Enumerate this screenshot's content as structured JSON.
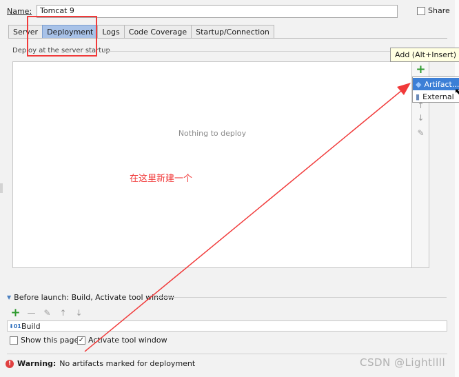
{
  "dialog": {
    "name_label": "Name:",
    "name_value": "Tomcat 9",
    "share_label": "Share",
    "share_checked": false
  },
  "tabs": [
    {
      "label": "Server",
      "active": false
    },
    {
      "label": "Deployment",
      "active": true
    },
    {
      "label": "Logs",
      "active": false
    },
    {
      "label": "Code Coverage",
      "active": false
    },
    {
      "label": "Startup/Connection",
      "active": false
    }
  ],
  "deployment": {
    "group_label": "Deploy at the server startup",
    "empty_text": "Nothing to deploy",
    "toolbar_icons": [
      "add-icon",
      "arrow-up-icon",
      "arrow-down-icon",
      "edit-icon"
    ],
    "tooltip": "Add (Alt+Insert)",
    "popup_items": [
      {
        "label": "Artifact...",
        "icon": "artifact-icon",
        "selected": true
      },
      {
        "label": "External",
        "icon": "external-icon",
        "selected": false
      }
    ]
  },
  "annotation": {
    "text": "在这里新建一个",
    "color": "#f13a3a"
  },
  "before_launch": {
    "title": "Before launch: Build, Activate tool window",
    "toolbar_icons": [
      "add-icon",
      "remove-icon",
      "edit-icon",
      "arrow-up-icon",
      "arrow-down-icon"
    ],
    "tasks": [
      "Build"
    ],
    "show_page_label": "Show this page",
    "show_page_checked": false,
    "activate_label": "Activate tool window",
    "activate_checked": true
  },
  "status": {
    "warning_label": "Warning:",
    "warning_text": "No artifacts marked for deployment"
  },
  "watermark": "CSDN @Lightllll",
  "colors": {
    "active_tab": "#a8c2e8",
    "selection": "#3c7fd6",
    "add_icon": "#2e9a2e",
    "annotation_red": "#f13a3a"
  }
}
